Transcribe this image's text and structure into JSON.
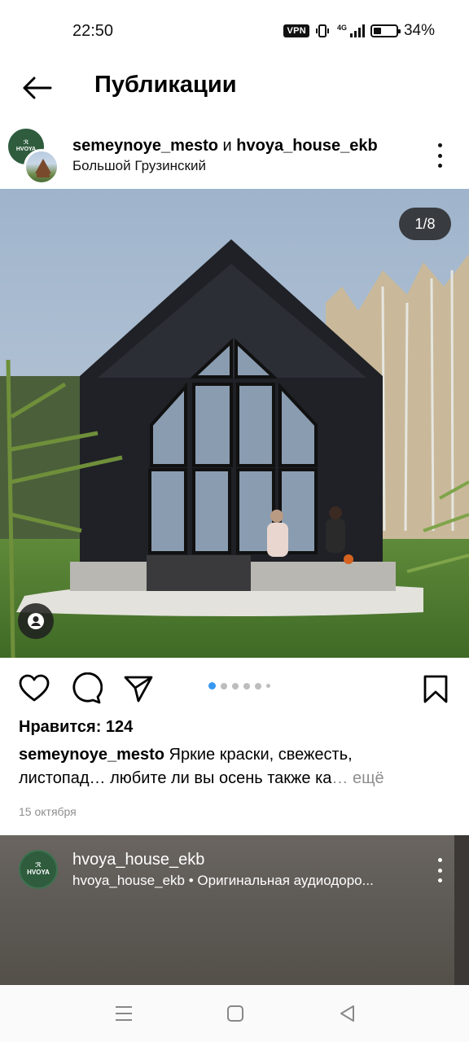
{
  "status_bar": {
    "time": "22:50",
    "vpn": "VPN",
    "network": "4G",
    "battery": "34%",
    "battery_level": 0.34
  },
  "header": {
    "title": "Публикации"
  },
  "post": {
    "user1": "semeynoye_mesto",
    "joiner": " и ",
    "user2": "hvoya_house_ekb",
    "location": "Большой Грузинский",
    "avatar_text_top": "ℛ",
    "avatar_text": "HVOYA",
    "counter": "1/8",
    "likes": "Нравится: 124",
    "caption_user": "semeynoye_mesto",
    "caption_text": " Яркие краски, свежесть, листопад… любите ли вы осень также ка",
    "caption_ellipsis": "…",
    "caption_more": " ещё",
    "date": "15 октября"
  },
  "next_post": {
    "avatar_text_top": "ℛ",
    "avatar_text": "HVOYA",
    "username": "hvoya_house_ekb",
    "audio": "hvoya_house_ekb • Оригинальная аудиодоро..."
  },
  "icons": {
    "back": "arrow-left",
    "more": "vertical-dots",
    "like": "heart",
    "comment": "speech-bubble",
    "share": "paper-plane",
    "save": "bookmark",
    "tag": "person",
    "nav_menu": "hamburger",
    "nav_home": "square",
    "nav_back": "triangle-left"
  },
  "colors": {
    "accent_dot": "#3897f0"
  }
}
